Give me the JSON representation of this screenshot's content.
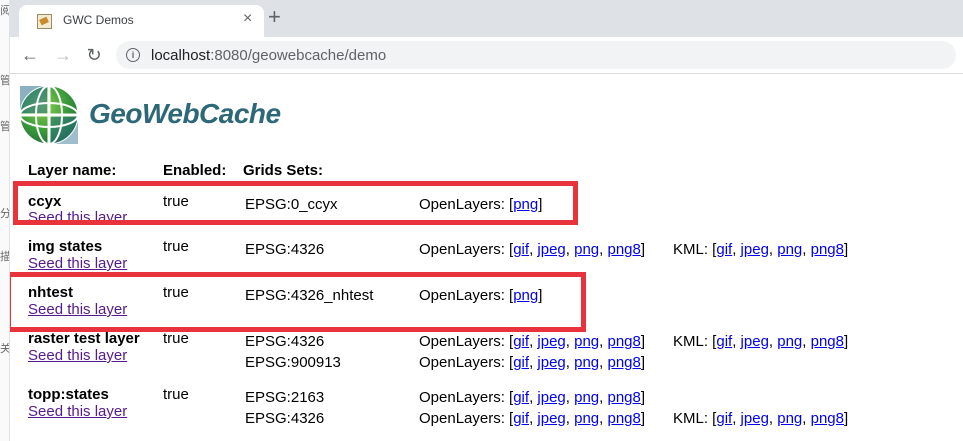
{
  "side_glyphs": [
    "阅",
    "管",
    "管",
    "分",
    "描",
    "关"
  ],
  "browser": {
    "tab_title": "GWC Demos",
    "tab_close": "×",
    "new_tab": "+",
    "back": "←",
    "forward": "→",
    "reload": "↻",
    "info_icon": "i",
    "url_host": "localhost",
    "url_rest": ":8080/geowebcache/demo"
  },
  "logo_text": "GeoWebCache",
  "headers": {
    "layer_name": "Layer name:",
    "enabled": "Enabled:",
    "grid_sets": "Grids Sets:"
  },
  "seed_label": "Seed this layer",
  "openlayers_label": "OpenLayers: [",
  "kml_label": "KML: [",
  "sep": ", ",
  "close_bracket": "]",
  "layers": [
    {
      "name": "ccyx",
      "enabled": "true",
      "grids": [
        {
          "name": "EPSG:0_ccyx",
          "ol": [
            "png"
          ],
          "kml": []
        }
      ]
    },
    {
      "name": "img states",
      "enabled": "true",
      "grids": [
        {
          "name": "EPSG:4326",
          "ol": [
            "gif",
            "jpeg",
            "png",
            "png8"
          ],
          "kml": [
            "gif",
            "jpeg",
            "png",
            "png8"
          ]
        }
      ]
    },
    {
      "name": "nhtest",
      "enabled": "true",
      "grids": [
        {
          "name": "EPSG:4326_nhtest",
          "ol": [
            "png"
          ],
          "kml": []
        }
      ]
    },
    {
      "name": "raster test layer",
      "enabled": "true",
      "grids": [
        {
          "name": "EPSG:4326",
          "ol": [
            "gif",
            "jpeg",
            "png",
            "png8"
          ],
          "kml": [
            "gif",
            "jpeg",
            "png",
            "png8"
          ]
        },
        {
          "name": "EPSG:900913",
          "ol": [
            "gif",
            "jpeg",
            "png",
            "png8"
          ],
          "kml": []
        }
      ]
    },
    {
      "name": "topp:states",
      "enabled": "true",
      "grids": [
        {
          "name": "EPSG:2163",
          "ol": [
            "gif",
            "jpeg",
            "png",
            "png8"
          ],
          "kml": []
        },
        {
          "name": "EPSG:4326",
          "ol": [
            "gif",
            "jpeg",
            "png",
            "png8"
          ],
          "kml": [
            "gif",
            "jpeg",
            "png",
            "png8"
          ]
        }
      ]
    }
  ],
  "highlight_color": "#e8323c",
  "link_color": "#0000ee",
  "visited_link_color": "#551a8b"
}
